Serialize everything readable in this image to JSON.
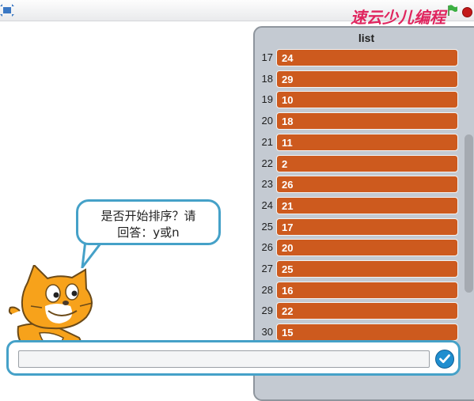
{
  "toolbar": {
    "fullscreen_icon": "fullscreen-icon",
    "brand_logo_text": "速云少儿编程",
    "green_flag_icon": "green-flag-icon",
    "stop_icon": "stop-sign-icon"
  },
  "speech_bubble": {
    "line1": "是否开始排序？请",
    "line2": "回答：y或n"
  },
  "list_monitor": {
    "title": "list",
    "rows": [
      {
        "index": "17",
        "value": "24"
      },
      {
        "index": "18",
        "value": "29"
      },
      {
        "index": "19",
        "value": "10"
      },
      {
        "index": "20",
        "value": "18"
      },
      {
        "index": "21",
        "value": "11"
      },
      {
        "index": "22",
        "value": "2"
      },
      {
        "index": "23",
        "value": "26"
      },
      {
        "index": "24",
        "value": "21"
      },
      {
        "index": "25",
        "value": "17"
      },
      {
        "index": "26",
        "value": "20"
      },
      {
        "index": "27",
        "value": "25"
      },
      {
        "index": "28",
        "value": "16"
      },
      {
        "index": "29",
        "value": "22"
      },
      {
        "index": "30",
        "value": "15"
      }
    ]
  },
  "answer_panel": {
    "input_value": "",
    "submit_icon": "checkmark-icon"
  },
  "colors": {
    "list_item": "#cd5a1e",
    "bubble_border": "#45a1c8",
    "submit": "#1f8ecf",
    "stop": "#c41a1a",
    "flag": "#3cb043",
    "logo": "#e0245e"
  }
}
